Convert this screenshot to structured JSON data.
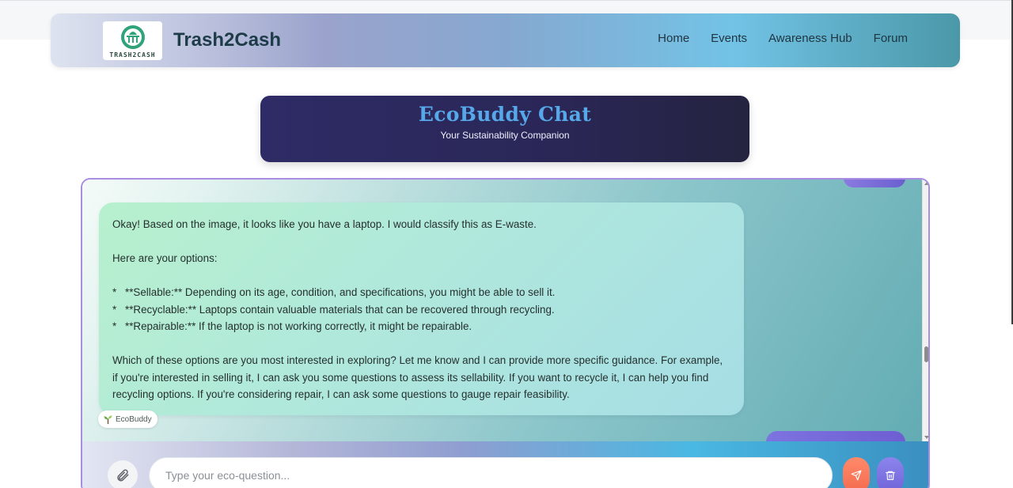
{
  "navbar": {
    "logo_text": "TRASH2CASH",
    "brand": "Trash2Cash",
    "links": [
      "Home",
      "Events",
      "Awareness Hub",
      "Forum"
    ]
  },
  "chat_header": {
    "title": "EcoBuddy Chat",
    "subtitle": "Your Sustainability Companion"
  },
  "bot_message": {
    "intro": "Okay! Based on the image, it looks like you have a laptop. I would classify this as E-waste.",
    "options_heading": "Here are your options:",
    "bullets": [
      "**Sellable:** Depending on its age, condition, and specifications, you might be able to sell it.",
      "**Recyclable:** Laptops contain valuable materials that can be recovered through recycling.",
      "**Repairable:** If the laptop is not working correctly, it might be repairable."
    ],
    "bullet_marker": "*",
    "closing": "Which of these options are you most interested in exploring? Let me know and I can provide more specific guidance. For example, if you're interested in selling it, I can ask you some questions to assess its sellability. If you want to recycle it, I can help you find recycling options. If you're considering repair, I can ask some questions to gauge repair feasibility.",
    "sender": "EcoBuddy"
  },
  "input": {
    "placeholder": "Type your eco-question...",
    "value": ""
  },
  "icons": {
    "attach": "paperclip-icon",
    "send": "send-icon",
    "clear": "trash-icon",
    "sender": "sprout-icon"
  },
  "colors": {
    "header_bg": "#2e2b66",
    "title": "#56a8e8",
    "send_button": "#f46a4e",
    "clear_button": "#6f62d8",
    "chat_border": "#a98de0"
  }
}
